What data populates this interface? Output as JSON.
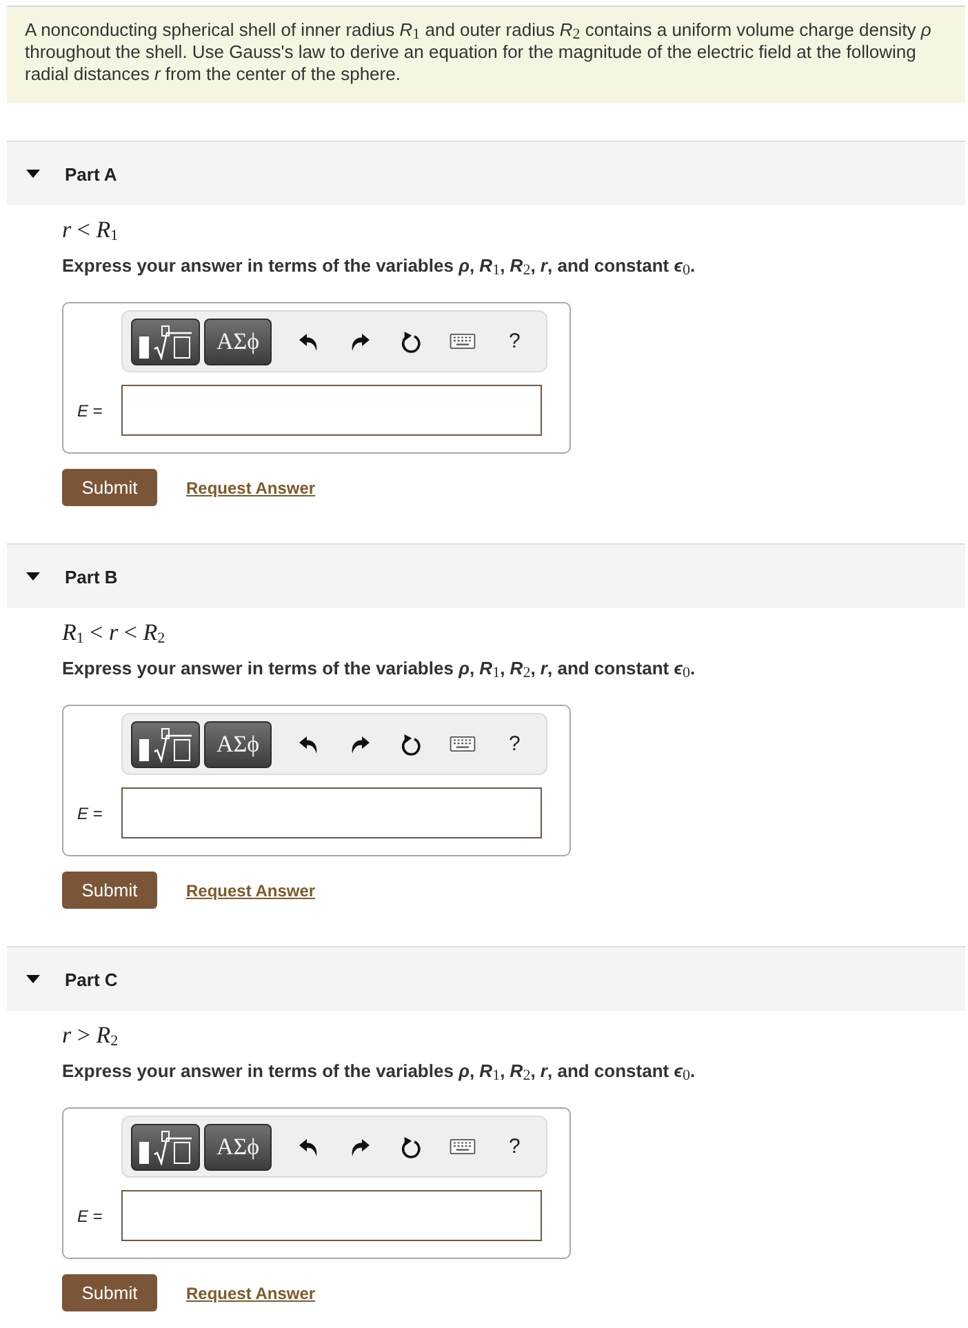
{
  "intro": "A nonconducting spherical shell of inner radius *R*$_{1}$ and outer radius *R*$_{2}$ contains a uniform volume charge density *ρ* throughout the shell. Use Gauss's law to derive an equation for the magnitude of the electric field at the following radial distances *r* from the center of the sphere.",
  "parts": [
    {
      "title": "Part A",
      "expanded": true,
      "condition": "*r* < *R*$_{1}$",
      "instruction": "Express your answer in terms of the variables *ρ*, *R*$_{1}$, *R*$_{2}$, *r*, and constant *ϵ*$_{0}$.",
      "toolbar": {
        "symbols": "ΑΣϕ",
        "help": "?"
      },
      "answer_label": "*E* =",
      "submit": "Submit",
      "request_answer": "Request Answer"
    },
    {
      "title": "Part B",
      "expanded": true,
      "condition": "*R*$_{1}$ < *r* < *R*$_{2}$",
      "instruction": "Express your answer in terms of the variables *ρ*, *R*$_{1}$, *R*$_{2}$, *r*, and constant *ϵ*$_{0}$.",
      "toolbar": {
        "symbols": "ΑΣϕ",
        "help": "?"
      },
      "answer_label": "*E* =",
      "submit": "Submit",
      "request_answer": "Request Answer"
    },
    {
      "title": "Part C",
      "expanded": true,
      "condition": "*r* > *R*$_{2}$",
      "instruction": "Express your answer in terms of the variables *ρ*, *R*$_{1}$, *R*$_{2}$, *r*, and constant *ϵ*$_{0}$.",
      "toolbar": {
        "symbols": "ΑΣϕ",
        "help": "?"
      },
      "answer_label": "*E* =",
      "submit": "Submit",
      "request_answer": "Request Answer"
    }
  ]
}
